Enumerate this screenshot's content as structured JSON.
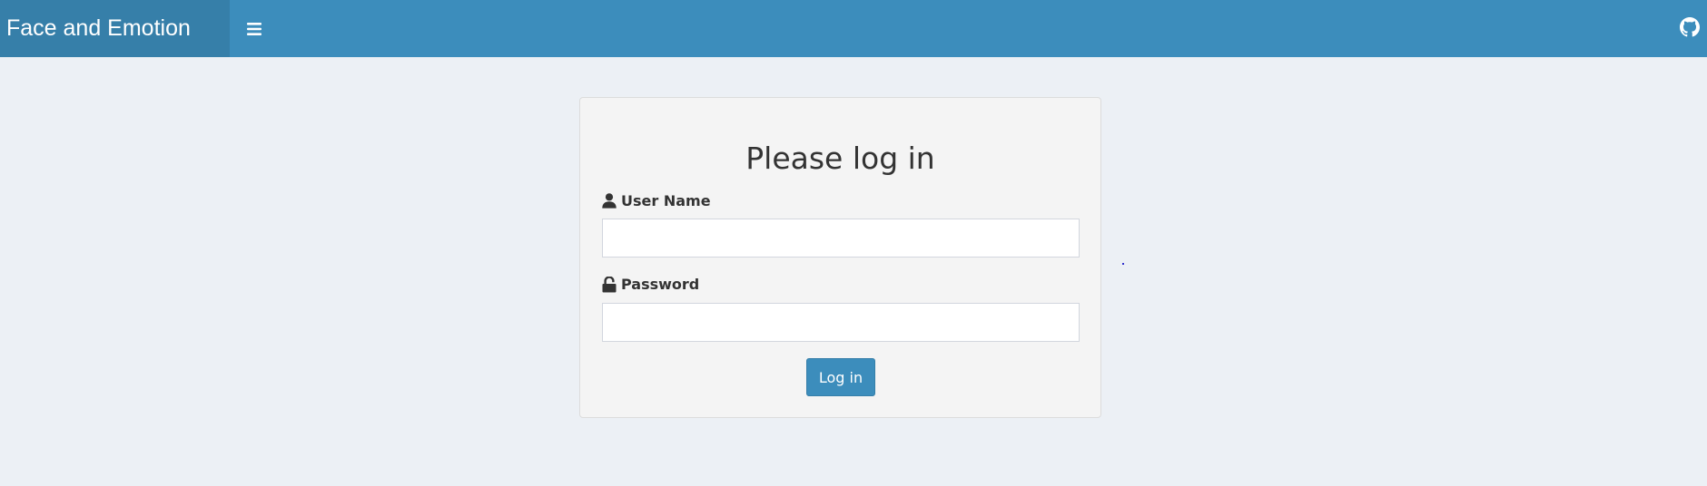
{
  "header": {
    "brand": "Face and Emotion",
    "menu_icon": "bars-icon",
    "github_icon": "github-icon"
  },
  "login": {
    "title": "Please log in",
    "username_label": "User Name",
    "username_icon": "user-icon",
    "username_value": "",
    "password_label": "Password",
    "password_icon": "unlock-icon",
    "password_value": "",
    "submit_label": "Log in"
  },
  "colors": {
    "header": "#3c8dbc",
    "brand_bg": "#367fa9",
    "page_bg": "#ecf0f5",
    "panel_bg": "#f4f4f4",
    "button": "#3c8dbc"
  }
}
